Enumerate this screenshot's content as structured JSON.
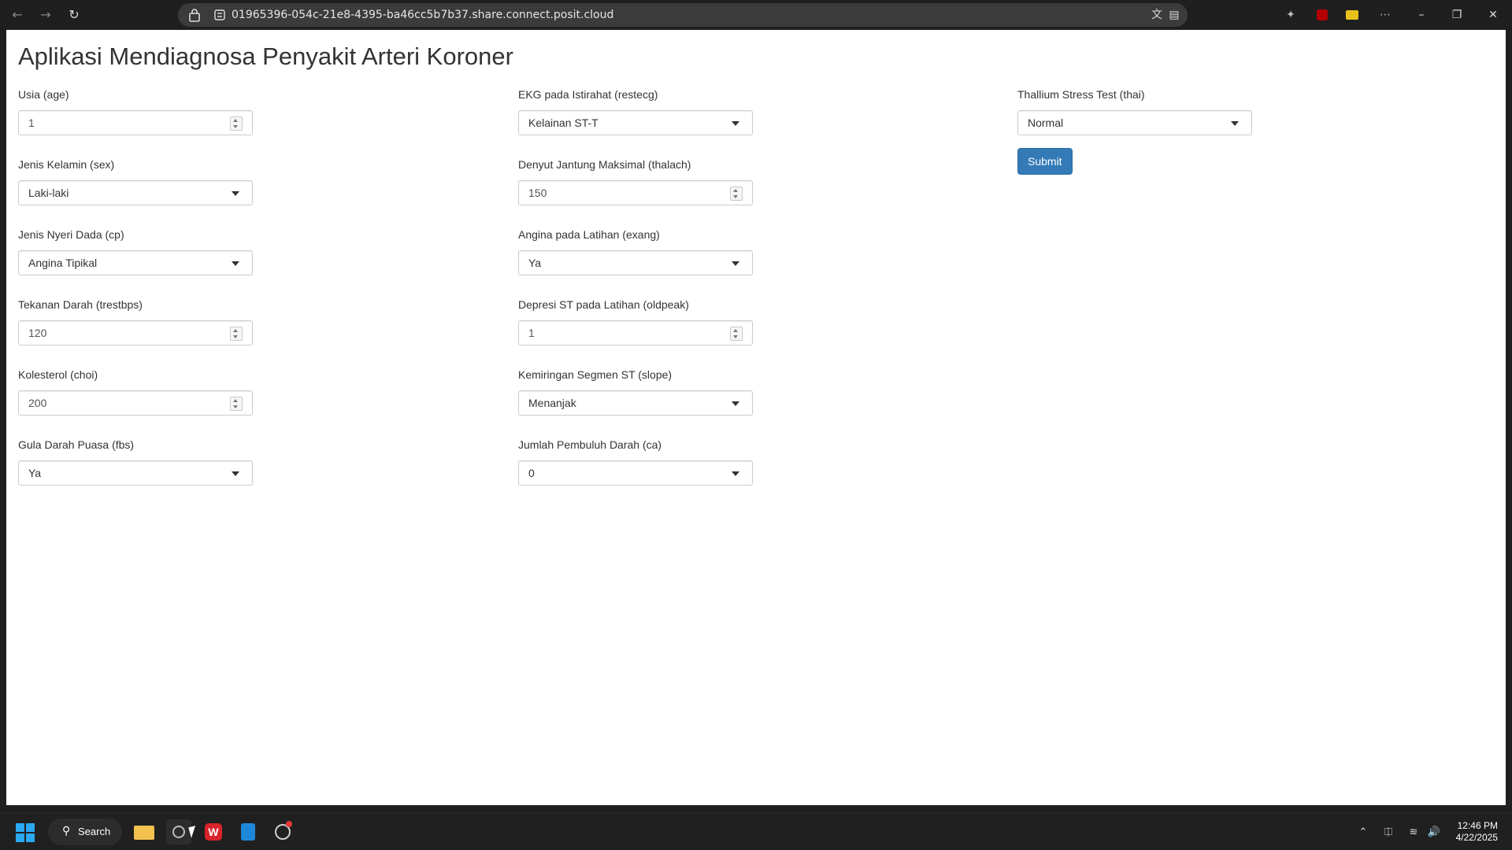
{
  "browser": {
    "url": "01965396-054c-21e8-4395-ba46cc5b7b37.share.connect.posit.cloud"
  },
  "page": {
    "title": "Aplikasi Mendiagnosa Penyakit Arteri Koroner",
    "submit_label": "Submit"
  },
  "fields": {
    "age": {
      "label": "Usia (age)",
      "value": "1"
    },
    "sex": {
      "label": "Jenis Kelamin (sex)",
      "value": "Laki-laki"
    },
    "cp": {
      "label": "Jenis Nyeri Dada (cp)",
      "value": "Angina Tipikal"
    },
    "trestbps": {
      "label": "Tekanan Darah (trestbps)",
      "value": "120"
    },
    "chol": {
      "label": "Kolesterol (choi)",
      "value": "200"
    },
    "fbs": {
      "label": "Gula Darah Puasa (fbs)",
      "value": "Ya"
    },
    "restecg": {
      "label": "EKG pada Istirahat (restecg)",
      "value": "Kelainan ST-T"
    },
    "thalach": {
      "label": "Denyut Jantung Maksimal (thalach)",
      "value": "150"
    },
    "exang": {
      "label": "Angina pada Latihan (exang)",
      "value": "Ya"
    },
    "oldpeak": {
      "label": "Depresi ST pada Latihan (oldpeak)",
      "value": "1"
    },
    "slope": {
      "label": "Kemiringan Segmen ST (slope)",
      "value": "Menanjak"
    },
    "ca": {
      "label": "Jumlah Pembuluh Darah (ca)",
      "value": "0"
    },
    "thal": {
      "label": "Thallium Stress Test (thai)",
      "value": "Normal"
    }
  },
  "taskbar": {
    "search_label": "Search",
    "time": "12:46 PM",
    "date": "4/22/2025"
  },
  "colors": {
    "primary_button": "#337ab7",
    "start_logo": "#2aa8f2"
  }
}
